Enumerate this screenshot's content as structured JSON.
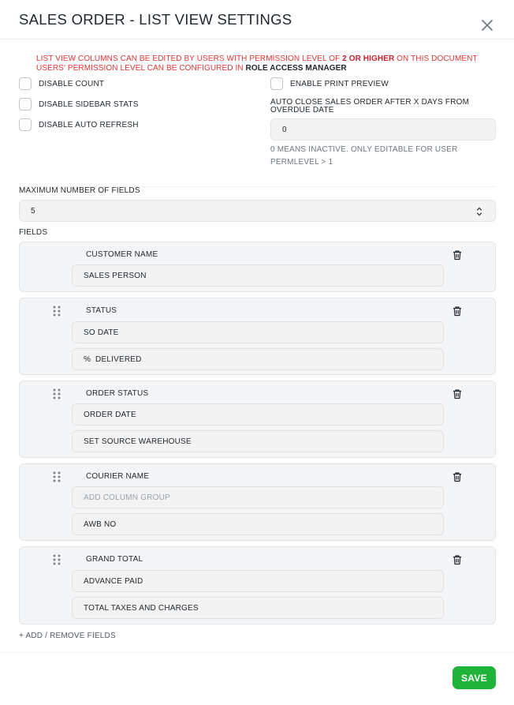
{
  "modal": {
    "title": "SALES ORDER - LIST VIEW SETTINGS",
    "close_icon": "close-icon"
  },
  "permission_note": {
    "part1": "LIST VIEW COLUMNS CAN BE EDITED BY USERS WITH PERMISSION LEVEL OF ",
    "level": "2 OR HIGHER",
    "part2": " ON THIS DOCUMENT",
    "line2": "USERS' PERMISSION LEVEL CAN BE CONFIGURED IN ",
    "manager": "ROLE ACCESS MANAGER"
  },
  "options": {
    "disable_count": "DISABLE COUNT",
    "disable_sidebar_stats": "DISABLE SIDEBAR STATS",
    "disable_auto_refresh": "DISABLE AUTO REFRESH",
    "enable_print_preview": "ENABLE PRINT PREVIEW"
  },
  "auto_close": {
    "label_line1": "AUTO CLOSE SALES ORDER AFTER X DAYS FROM",
    "label_line2": "OVERDUE DATE",
    "value": "0",
    "help_line1": "0 MEANS INACTIVE. ONLY EDITABLE FOR USER",
    "help_line2": "PERMLEVEL > 1"
  },
  "max_fields": {
    "label": "MAXIMUM NUMBER OF FIELDS",
    "value": "5"
  },
  "fields_label": "FIELDS",
  "field_groups": [
    {
      "group": "CUSTOMER NAME",
      "fields": [
        "SALES PERSON"
      ]
    },
    {
      "group": "STATUS",
      "fields": [
        "SO DATE",
        "%  DELIVERED"
      ]
    },
    {
      "group": "ORDER STATUS",
      "fields": [
        "ORDER DATE",
        "SET SOURCE WAREHOUSE"
      ]
    },
    {
      "group": "COURIER NAME",
      "placeholder": "ADD COLUMN GROUP",
      "fields": [
        "AWB NO"
      ]
    },
    {
      "group": "GRAND TOTAL",
      "fields": [
        "ADVANCE PAID",
        "TOTAL TAXES AND CHARGES"
      ]
    }
  ],
  "add_remove": "+ ADD / REMOVE FIELDS",
  "save_label": "SAVE",
  "colors": {
    "accent_green": "#1fb33a",
    "warning_red": "#e03636"
  }
}
